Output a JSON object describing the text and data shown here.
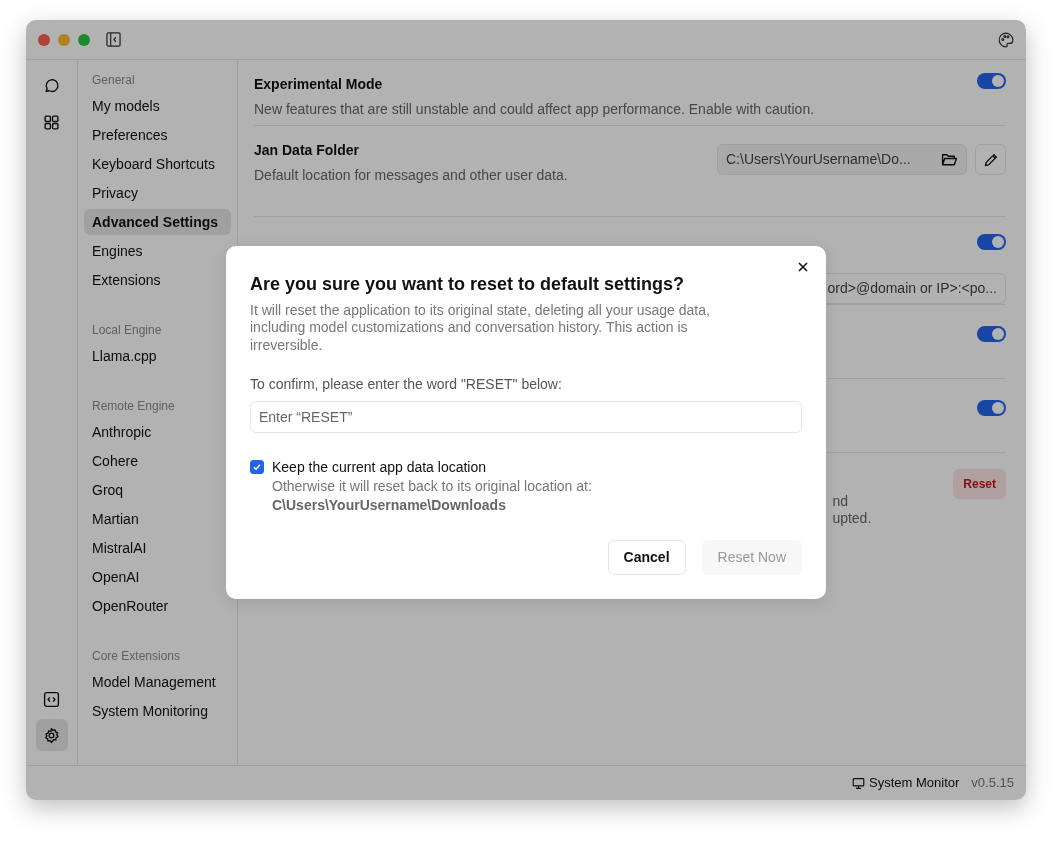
{
  "rail": {
    "top": [
      {
        "kind": "chat",
        "selected": false
      },
      {
        "kind": "grid",
        "selected": false
      }
    ],
    "bottom": [
      {
        "kind": "code",
        "selected": false
      },
      {
        "kind": "settings",
        "selected": true
      }
    ]
  },
  "sidebar": {
    "sections": [
      {
        "heading": "General",
        "items": [
          {
            "label": "My models",
            "selected": false
          },
          {
            "label": "Preferences",
            "selected": false
          },
          {
            "label": "Keyboard Shortcuts",
            "selected": false
          },
          {
            "label": "Privacy",
            "selected": false
          },
          {
            "label": "Advanced Settings",
            "selected": true
          },
          {
            "label": "Engines",
            "selected": false
          },
          {
            "label": "Extensions",
            "selected": false
          }
        ]
      },
      {
        "heading": "Local Engine",
        "items": [
          {
            "label": "Llama.cpp",
            "selected": false
          }
        ]
      },
      {
        "heading": "Remote Engine",
        "items": [
          {
            "label": "Anthropic",
            "selected": false
          },
          {
            "label": "Cohere",
            "selected": false
          },
          {
            "label": "Groq",
            "selected": false
          },
          {
            "label": "Martian",
            "selected": false
          },
          {
            "label": "MistralAI",
            "selected": false
          },
          {
            "label": "OpenAI",
            "selected": false
          },
          {
            "label": "OpenRouter",
            "selected": false
          }
        ]
      },
      {
        "heading": "Core Extensions",
        "items": [
          {
            "label": "Model Management",
            "selected": false
          },
          {
            "label": "System Monitoring",
            "selected": false
          }
        ]
      }
    ]
  },
  "settings": [
    {
      "kind": "toggle",
      "title": "Experimental Mode",
      "description": "New features that are still unstable and could affect app performance. Enable with caution.",
      "on": true
    },
    {
      "kind": "folder",
      "title": "Jan Data Folder",
      "description": "Default location for messages and other user data.",
      "value": "C:\\Users\\YourUsername\\Do..."
    },
    {
      "kind": "proxy",
      "on": true,
      "value": "ord>@domain or IP>:<po..."
    },
    {
      "kind": "toggle",
      "on": true
    },
    {
      "kind": "toggle",
      "on": true
    },
    {
      "kind": "reset",
      "description_lines": [
        "nd",
        "upted."
      ],
      "button": "Reset"
    }
  ],
  "dialog": {
    "title": "Are you sure you want to reset to default settings?",
    "message": "It will reset the application to its original state, deleting all your usage data, including model customizations and conversation history. This action is irreversible.",
    "confirm_label": "To confirm, please enter the word \"RESET\" below:",
    "placeholder": "Enter “RESET”",
    "keep": {
      "label": "Keep the current app data location",
      "checked": true,
      "note": "Otherwise it will reset back to its original location at:",
      "path": "C\\Users\\YourUsername\\Downloads"
    },
    "buttons": [
      {
        "label": "Cancel",
        "disabled": false
      },
      {
        "label": "Reset Now",
        "disabled": true
      }
    ]
  },
  "status_bar": {
    "monitor": "System Monitor",
    "version": "v0.5.15"
  }
}
